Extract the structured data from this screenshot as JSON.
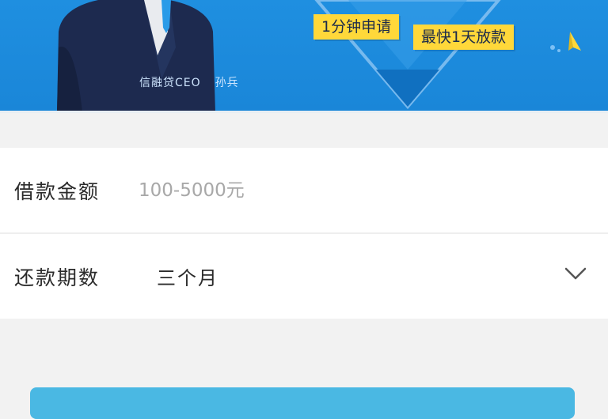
{
  "banner": {
    "ceo_title": "信融贷CEO",
    "ceo_name": "孙兵",
    "tag_apply": "1分钟申请",
    "tag_fast": "最快1天放款"
  },
  "form": {
    "amount": {
      "label": "借款金额",
      "placeholder": "100-5000元"
    },
    "term": {
      "label": "还款期数",
      "value": "三个月"
    }
  },
  "colors": {
    "banner_blue": "#1f8fe0",
    "tag_yellow": "#ffd83a",
    "button_blue": "#4ab8e3"
  },
  "icons": [
    "chevron-down-icon",
    "paper-plane-icon"
  ]
}
